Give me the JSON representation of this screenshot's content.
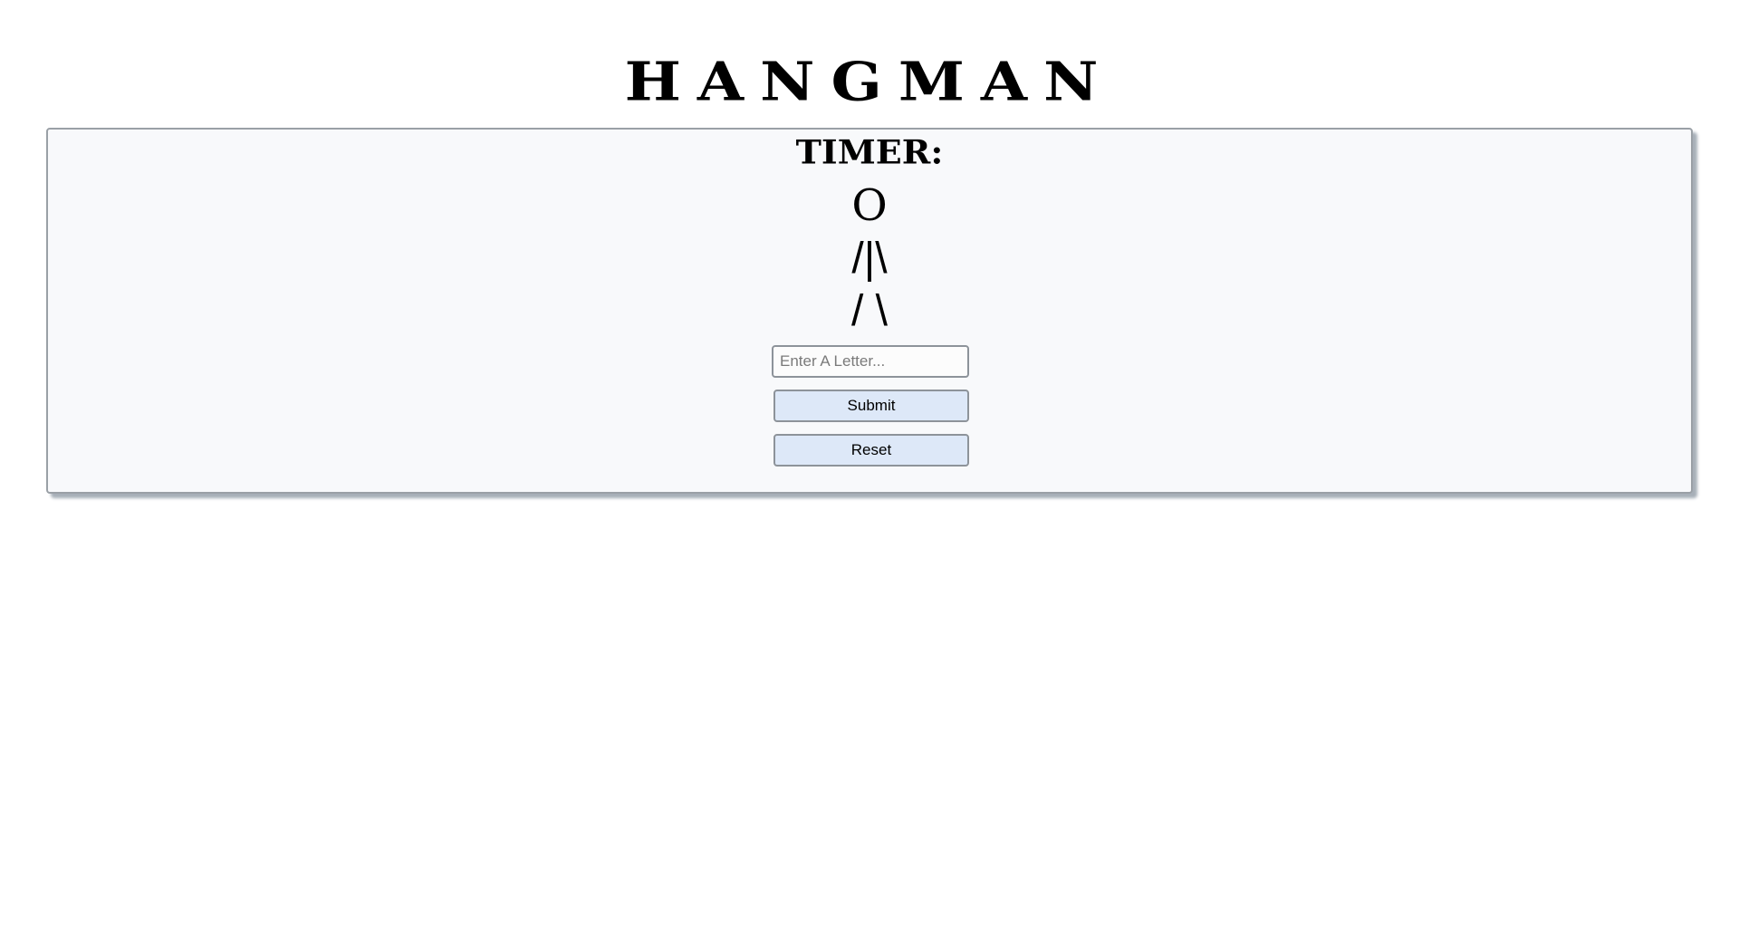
{
  "page": {
    "title": "HANGMAN"
  },
  "game": {
    "timer_label": "TIMER:",
    "figure": {
      "head": "O",
      "torso": "/|\\",
      "legs": "/ \\"
    },
    "letter_input": {
      "value": "",
      "placeholder": "Enter A Letter..."
    },
    "submit_label": "Submit",
    "reset_label": "Reset"
  },
  "colors": {
    "panel_background": "#f8f9fb",
    "button_background": "#dde8f8",
    "border": "#9aa0a6"
  }
}
